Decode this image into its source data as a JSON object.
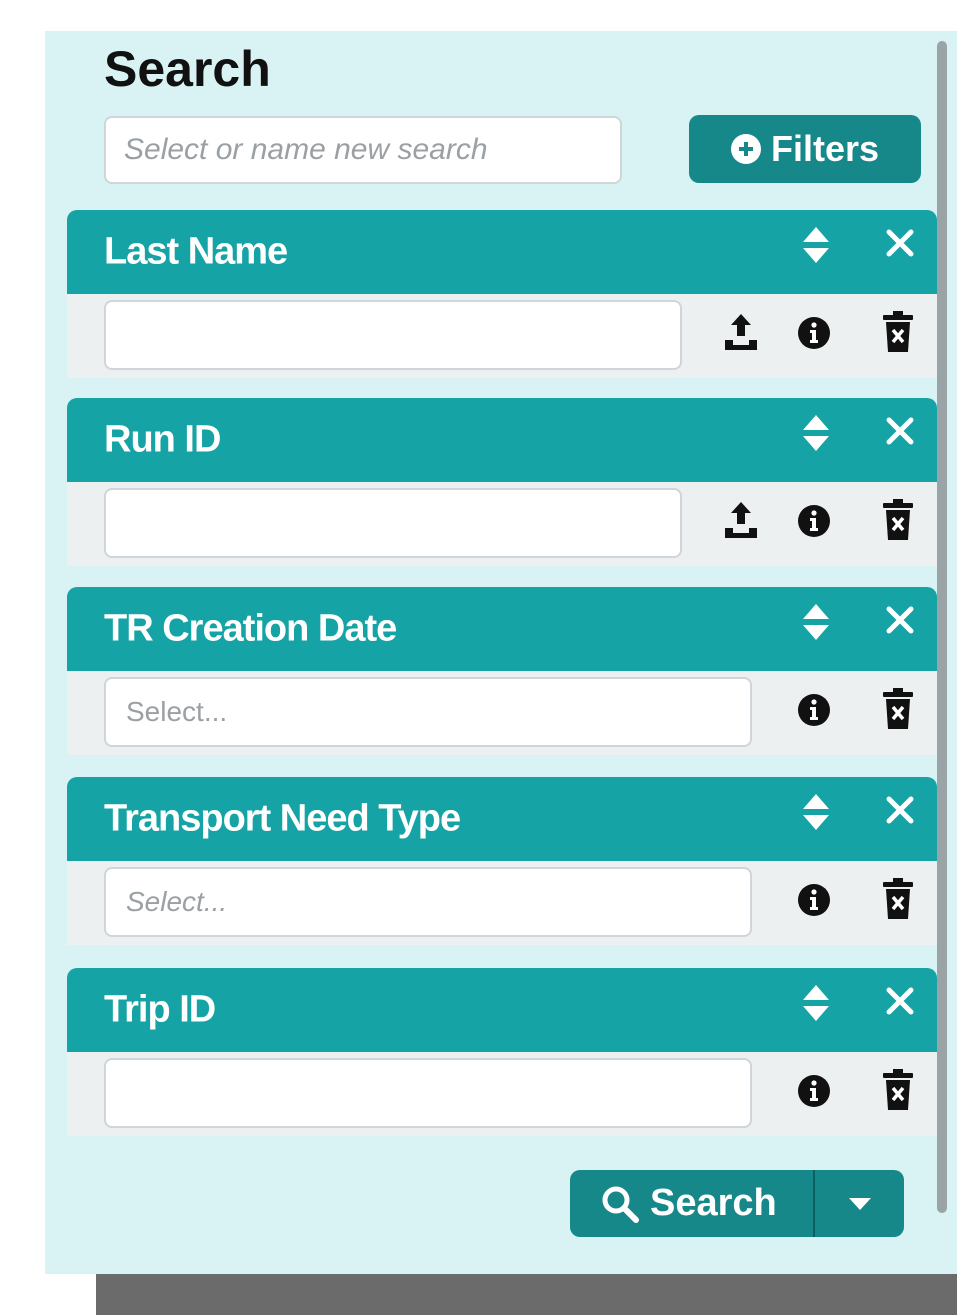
{
  "panel": {
    "title": "Search",
    "search_name_placeholder": "Select or name new search",
    "filters_label": "Filters",
    "search_label": "Search"
  },
  "colors": {
    "panel_bg": "#d9f3f5",
    "header_teal": "#15a3a5",
    "button_teal": "#17888a"
  },
  "filters": [
    {
      "title": "Last Name",
      "value": "",
      "placeholder": "",
      "icons": [
        "upload-icon",
        "info-icon",
        "trash-icon"
      ]
    },
    {
      "title": "Run ID",
      "value": "",
      "placeholder": "",
      "icons": [
        "upload-icon",
        "info-icon",
        "trash-icon"
      ]
    },
    {
      "title": "TR Creation Date",
      "value": "",
      "placeholder": "Select...",
      "icons": [
        "info-icon",
        "trash-icon"
      ]
    },
    {
      "title": "Transport Need Type",
      "value": "",
      "placeholder": "Select...",
      "icons": [
        "info-icon",
        "trash-icon"
      ]
    },
    {
      "title": "Trip ID",
      "value": "",
      "placeholder": "",
      "icons": [
        "info-icon",
        "trash-icon"
      ]
    }
  ]
}
